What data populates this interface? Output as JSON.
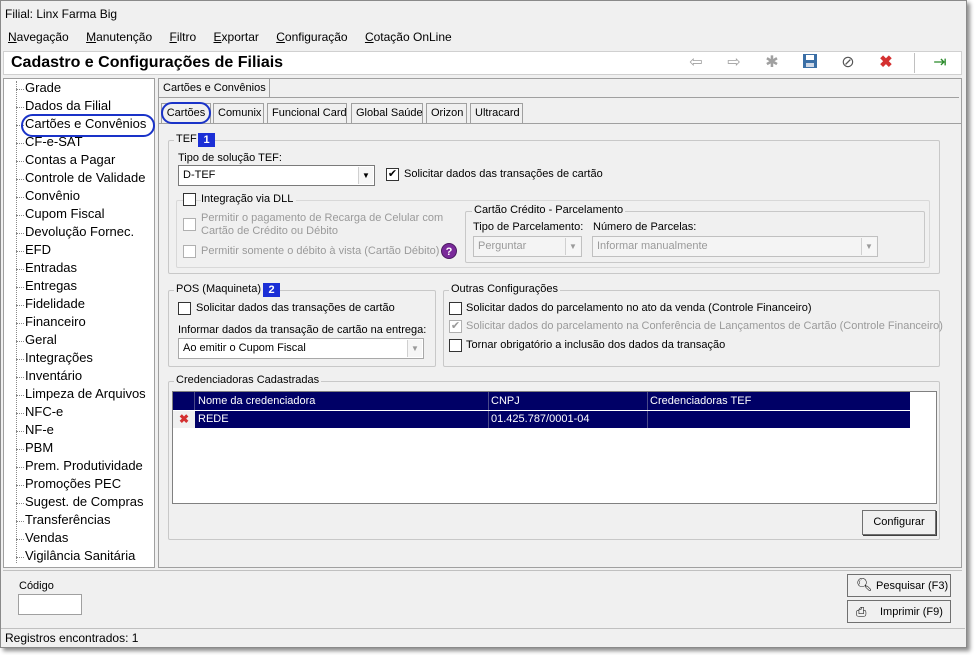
{
  "window_title": "Filial: Linx Farma Big",
  "menu": [
    {
      "label": "Navegação",
      "hotkey": "N"
    },
    {
      "label": "Manutenção",
      "hotkey": "M"
    },
    {
      "label": "Filtro",
      "hotkey": "F"
    },
    {
      "label": "Exportar",
      "hotkey": "E"
    },
    {
      "label": "Configuração",
      "hotkey": "C"
    },
    {
      "label": "Cotação OnLine",
      "hotkey": "C"
    }
  ],
  "page_title": "Cadastro e Configurações de Filiais",
  "toolbar_icons": [
    "arrow-left-icon",
    "arrow-right-icon",
    "new-icon",
    "save-icon",
    "cancel-icon",
    "delete-icon",
    "exit-icon"
  ],
  "sidebar": {
    "items": [
      "Grade",
      "Dados da Filial",
      "Cartões e Convênios",
      "CF-e-SAT",
      "Contas a Pagar",
      "Controle de Validade",
      "Convênio",
      "Cupom Fiscal",
      "Devolução Fornec.",
      "EFD",
      "Entradas",
      "Entregas",
      "Fidelidade",
      "Financeiro",
      "Geral",
      "Integrações",
      "Inventário",
      "Limpeza de Arquivos",
      "NFC-e",
      "NF-e",
      "PBM",
      "Prem. Produtividade",
      "Promoções PEC",
      "Sugest. de Compras",
      "Transferências",
      "Vendas",
      "Vigilância Sanitária"
    ],
    "selected": "Cartões e Convênios"
  },
  "outer_tab": "Cartões e Convênios",
  "inner_tabs": [
    "Cartões",
    "Comunix",
    "Funcional Card",
    "Global Saúde",
    "Orizon",
    "Ultracard"
  ],
  "tef": {
    "title": "TEF",
    "badge": "1",
    "tipo_label": "Tipo de solução TEF:",
    "tipo_value": "D-TEF",
    "solicitar_label": "Solicitar dados das transações de cartão",
    "solicitar_checked": true,
    "dll_label": "Integração via DLL",
    "recarga_label_1": "Permitir o pagamento de Recarga de Celular com",
    "recarga_label_2": "Cartão de Crédito ou Débito",
    "debito_label": "Permitir somente o débito à vista (Cartão Débito)",
    "help": "?",
    "parcelamento": {
      "title": "Cartão Crédito - Parcelamento",
      "tipo_label": "Tipo de Parcelamento:",
      "tipo_value": "Perguntar",
      "numero_label": "Número de Parcelas:",
      "numero_value": "Informar manualmente"
    }
  },
  "pos": {
    "title": "POS (Maquineta)",
    "badge": "2",
    "solicitar_label": "Solicitar dados das transações de cartão",
    "entrega_label": "Informar dados da transação de cartão na entrega:",
    "entrega_value": "Ao emitir o Cupom Fiscal"
  },
  "outras": {
    "title": "Outras Configurações",
    "opt1": "Solicitar dados do parcelamento no ato da venda (Controle Financeiro)",
    "opt2": "Solicitar dados do parcelamento na Conferência de Lançamentos de Cartão (Controle Financeiro)",
    "opt3": "Tornar obrigatório a inclusão dos dados da transação"
  },
  "credenciadoras": {
    "title": "Credenciadoras Cadastradas",
    "columns": [
      "Nome da credenciadora",
      "CNPJ",
      "Credenciadoras TEF"
    ],
    "rows": [
      {
        "nome": "REDE",
        "cnpj": "01.425.787/0001-04",
        "tef": ""
      }
    ],
    "configurar": "Configurar"
  },
  "codigo_label": "Código",
  "codigo_value": "",
  "pesquisar": "Pesquisar (F3)",
  "imprimir": "Imprimir (F9)",
  "status": "Registros encontrados: 1",
  "colors": {
    "grid_header": "#000066",
    "highlight": "#0000cc",
    "badge": "#1b2fd6",
    "delete": "#d43030"
  }
}
